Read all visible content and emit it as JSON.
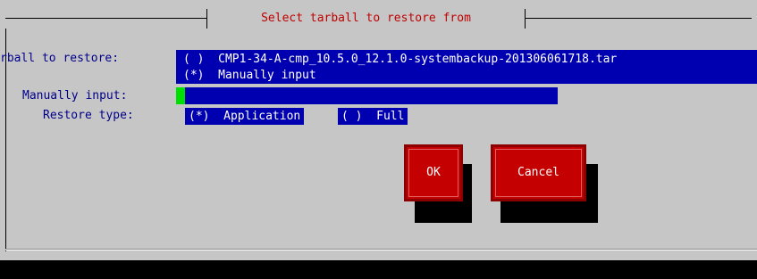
{
  "dialog": {
    "title": "Select tarball to restore from"
  },
  "form": {
    "tarball_label": "rball to restore:",
    "tarball_options": [
      "( )  CMP1-34-A-cmp_10.5.0_12.1.0-systembackup-201306061718.tar",
      "(*)  Manually input"
    ],
    "manual_label": "Manually input:",
    "manual_value": "",
    "restore_label": "Restore type:",
    "restore_options": {
      "application": "(*)  Application",
      "full": "( )  Full"
    }
  },
  "buttons": {
    "ok": "OK",
    "cancel": "Cancel"
  },
  "colors": {
    "background": "#c6c6c6",
    "field": "#0000b0",
    "label": "#00008a",
    "title": "#c00000",
    "button": "#c40000",
    "cursor": "#00e000"
  }
}
